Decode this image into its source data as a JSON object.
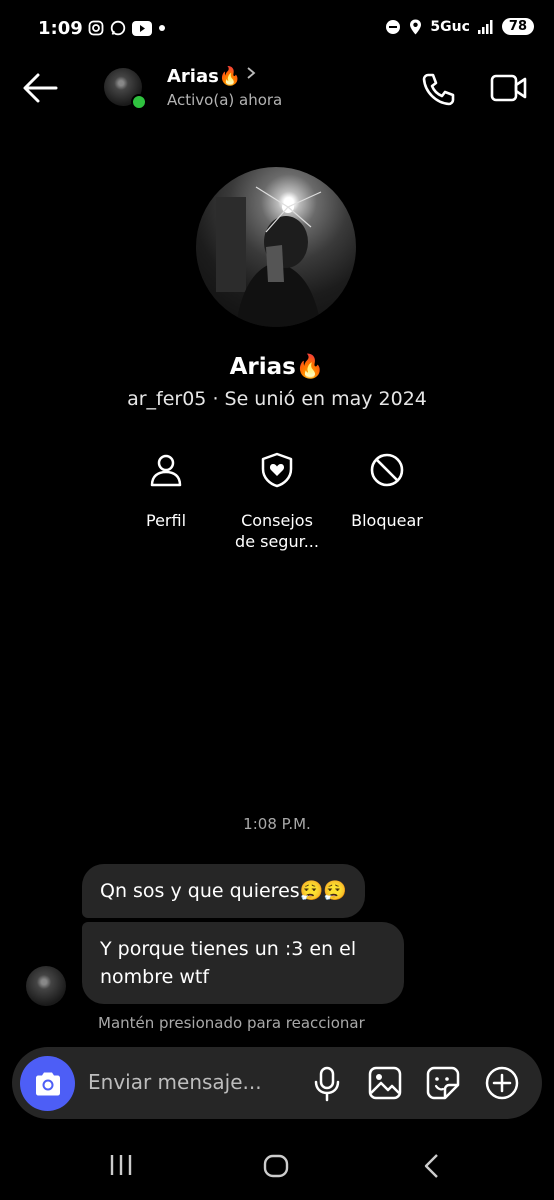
{
  "status_bar": {
    "time": "1:09",
    "network": "5Guc",
    "battery": "78"
  },
  "header": {
    "name": "Arias🔥",
    "status": "Activo(a) ahora"
  },
  "profile": {
    "name": "Arias🔥",
    "subtitle": "ar_fer05 · Se unió en may 2024"
  },
  "actions": [
    {
      "label": "Perfil",
      "icon": "person-icon"
    },
    {
      "label": "Consejos de segur...",
      "icon": "shield-heart-icon"
    },
    {
      "label": "Bloquear",
      "icon": "block-icon"
    }
  ],
  "chat": {
    "timestamp": "1:08 P.M.",
    "messages": [
      {
        "text": "Qn sos y que quieres😮‍💨😮‍💨"
      },
      {
        "text": "Y porque tienes un :3 en el nombre wtf"
      }
    ],
    "hint": "Mantén presionado para reaccionar"
  },
  "composer": {
    "placeholder": "Enviar mensaje..."
  },
  "colors": {
    "background": "#000000",
    "bubble": "#262626",
    "camera_button": "#4d5ef6",
    "online": "#2fc23f"
  }
}
